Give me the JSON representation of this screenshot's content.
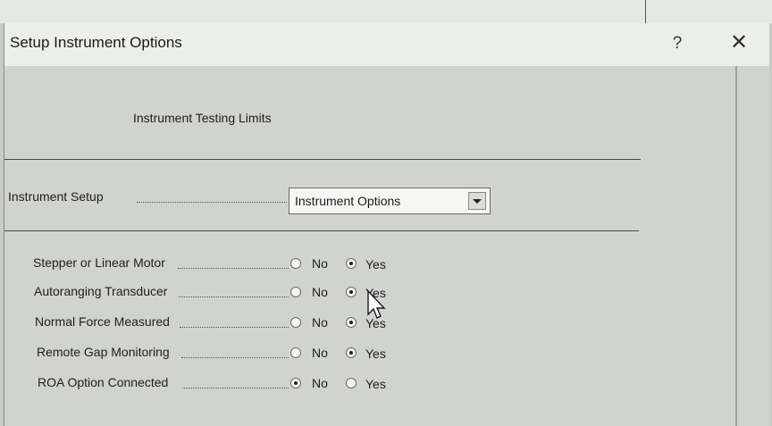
{
  "window": {
    "title": "Setup Instrument Options",
    "help_label": "?",
    "close_label": "✕"
  },
  "section_heading": "Instrument Testing Limits",
  "instrument_setup": {
    "label": "Instrument Setup",
    "selected": "Instrument Options"
  },
  "options": [
    {
      "label": "Stepper or Linear Motor",
      "no": "No",
      "yes": "Yes",
      "value": "Yes"
    },
    {
      "label": "Autoranging Transducer",
      "no": "No",
      "yes": "Yes",
      "value": "Yes"
    },
    {
      "label": "Normal Force Measured",
      "no": "No",
      "yes": "Yes",
      "value": "Yes"
    },
    {
      "label": "Remote Gap Monitoring",
      "no": "No",
      "yes": "Yes",
      "value": "Yes"
    },
    {
      "label": "ROA Option Connected",
      "no": "No",
      "yes": "Yes",
      "value": "No"
    }
  ]
}
